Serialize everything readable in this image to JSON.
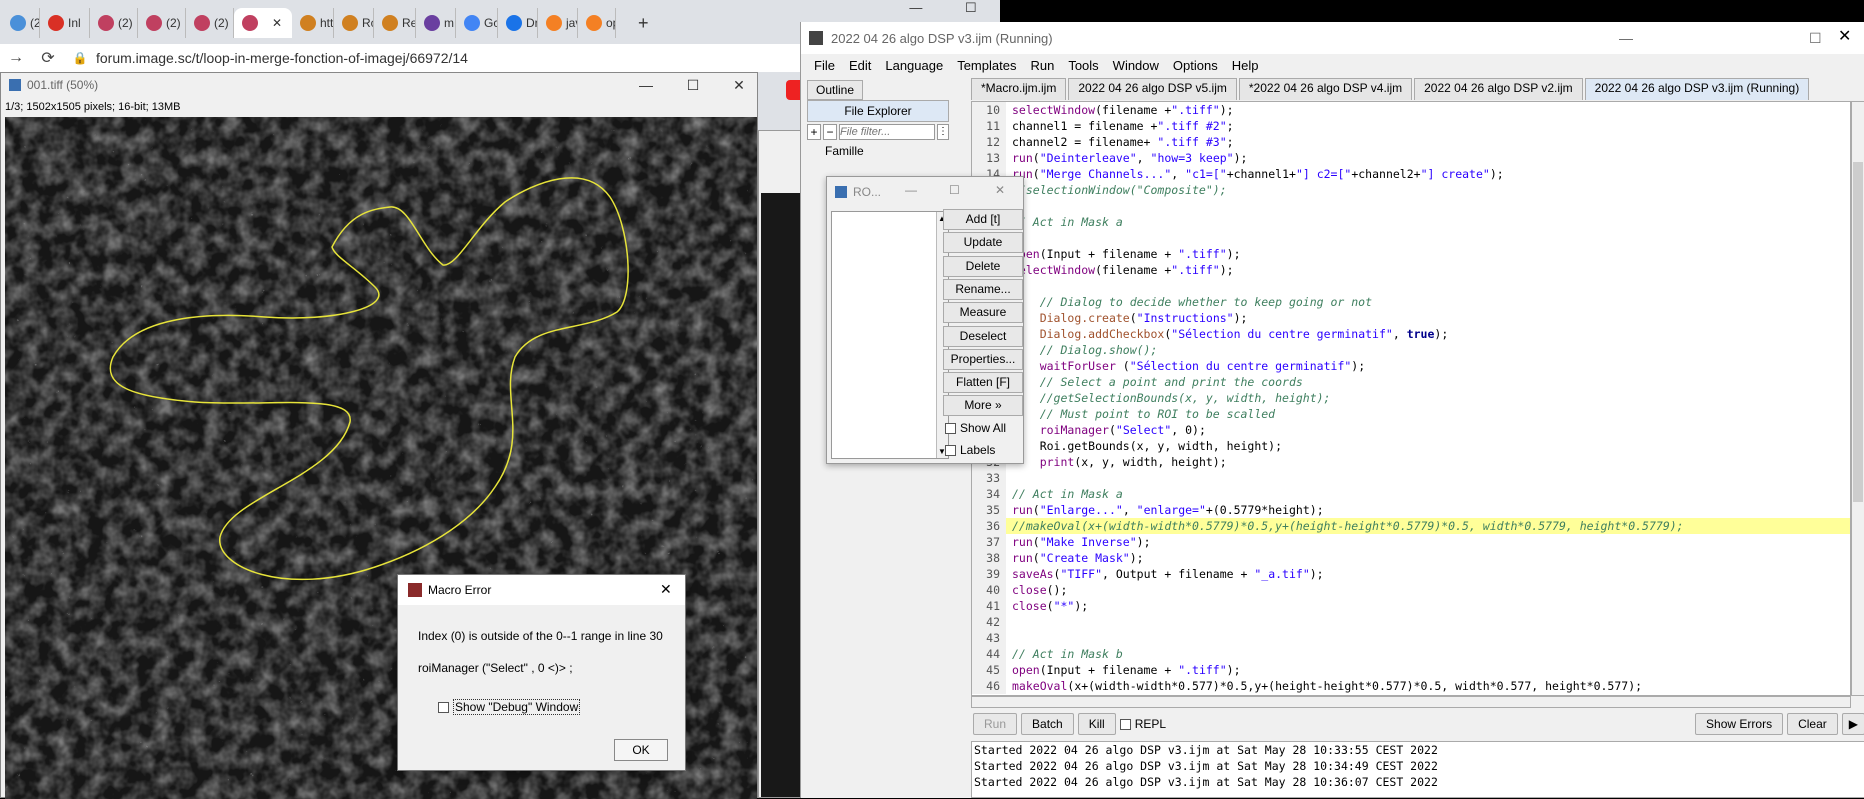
{
  "browser": {
    "tabs": [
      {
        "label": "(2)",
        "icon": "app-icon",
        "color": "#4a90d9"
      },
      {
        "label": "Inl",
        "icon": "gmail-icon",
        "color": "#d93025"
      },
      {
        "label": "(2)",
        "icon": "app-icon",
        "color": "#c04060"
      },
      {
        "label": "(2)",
        "icon": "app-icon",
        "color": "#c04060"
      },
      {
        "label": "(2)",
        "icon": "app-icon",
        "color": "#c04060"
      },
      {
        "label": "",
        "icon": "app-icon",
        "color": "#c04060"
      },
      {
        "label": "htt",
        "icon": "forum-icon",
        "color": "#d08020"
      },
      {
        "label": "Rc",
        "icon": "forum-icon",
        "color": "#d08020"
      },
      {
        "label": "Re",
        "icon": "forum-icon",
        "color": "#d08020"
      },
      {
        "label": "m",
        "icon": "app-icon",
        "color": "#6a3fa0"
      },
      {
        "label": "Gc",
        "icon": "translate-icon",
        "color": "#4285f4"
      },
      {
        "label": "Dr",
        "icon": "app-icon",
        "color": "#1a73e8"
      },
      {
        "label": "jav",
        "icon": "stack-icon",
        "color": "#f48024"
      },
      {
        "label": "op",
        "icon": "stack-icon",
        "color": "#f48024"
      }
    ],
    "url": "forum.image.sc/t/loop-in-merge-fonction-of-imagej/66972/14"
  },
  "image_window": {
    "title": "001.tiff (50%)",
    "info": "1/3; 1502x1505 pixels; 16-bit; 13MB"
  },
  "editor": {
    "title": "2022 04 26 algo DSP v3.ijm (Running)",
    "menu": [
      "File",
      "Edit",
      "Language",
      "Templates",
      "Run",
      "Tools",
      "Window",
      "Options",
      "Help"
    ],
    "side_tabs": [
      "Outline",
      "File Explorer"
    ],
    "file_filter_placeholder": "File filter...",
    "tree_item": "Famille",
    "tabs": [
      "*Macro.ijm.ijm",
      "2022 04 26 algo DSP v5.ijm",
      "*2022 04 26 algo DSP v4.ijm",
      "2022 04 26 algo DSP v2.ijm",
      "2022 04 26 algo DSP v3.ijm (Running)"
    ],
    "code": [
      {
        "n": "10",
        "t": "selectWindow(filename +\".tiff\");"
      },
      {
        "n": "11",
        "t": "channel1 = filename +\".tiff #2\";"
      },
      {
        "n": "12",
        "t": "channel2 = filename+ \".tiff #3\";"
      },
      {
        "n": "13",
        "t": "run(\"Deinterleave\", \"how=3 keep\");"
      },
      {
        "n": "14",
        "t": "run(\"Merge Channels...\", \"c1=[\"+channel1+\"] c2=[\"+channel2+\"] create\");"
      },
      {
        "n": "15",
        "t": "//selectionWindow(\"Composite\");"
      },
      {
        "n": "16",
        "t": ""
      },
      {
        "n": "17",
        "t": "// Act in Mask a"
      },
      {
        "n": "18",
        "t": ""
      },
      {
        "n": "19",
        "t": "open(Input + filename + \".tiff\");"
      },
      {
        "n": "20",
        "t": "selectWindow(filename +\".tiff\");"
      },
      {
        "n": "21",
        "t": ""
      },
      {
        "n": "22",
        "t": "    // Dialog to decide whether to keep going or not"
      },
      {
        "n": "23",
        "t": "    Dialog.create(\"Instructions\");"
      },
      {
        "n": "24",
        "t": "    Dialog.addCheckbox(\"Sélection du centre germinatif\", true);"
      },
      {
        "n": "25",
        "t": "    // Dialog.show();"
      },
      {
        "n": "26",
        "t": "    waitForUser (\"Sélection du centre germinatif\");"
      },
      {
        "n": "27",
        "t": "    // Select a point and print the coords"
      },
      {
        "n": "28",
        "t": "    //getSelectionBounds(x, y, width, height);"
      },
      {
        "n": "29",
        "t": "    // Must point to ROI to be scalled"
      },
      {
        "n": "30",
        "t": "    roiManager(\"Select\", 0);"
      },
      {
        "n": "31",
        "t": "    Roi.getBounds(x, y, width, height);"
      },
      {
        "n": "32",
        "t": "    print(x, y, width, height);"
      },
      {
        "n": "33",
        "t": ""
      },
      {
        "n": "34",
        "t": "// Act in Mask a"
      },
      {
        "n": "35",
        "t": "run(\"Enlarge...\", \"enlarge=\"+(0.5779*height);"
      },
      {
        "n": "36",
        "t": "//makeOval(x+(width-width*0.5779)*0.5,y+(height-height*0.5779)*0.5, width*0.5779, height*0.5779);"
      },
      {
        "n": "37",
        "t": "run(\"Make Inverse\");"
      },
      {
        "n": "38",
        "t": "run(\"Create Mask\");"
      },
      {
        "n": "39",
        "t": "saveAs(\"TIFF\", Output + filename + \"_a.tif\");"
      },
      {
        "n": "40",
        "t": "close();"
      },
      {
        "n": "41",
        "t": "close(\"*\");"
      },
      {
        "n": "42",
        "t": ""
      },
      {
        "n": "43",
        "t": ""
      },
      {
        "n": "44",
        "t": "// Act in Mask b"
      },
      {
        "n": "45",
        "t": "open(Input + filename + \".tiff\");"
      },
      {
        "n": "46",
        "t": "makeOval(x+(width-width*0.577)*0.5,y+(height-height*0.577)*0.5, width*0.577, height*0.577);"
      }
    ],
    "highlight_line": "36",
    "run_buttons": {
      "run": "Run",
      "batch": "Batch",
      "kill": "Kill",
      "repl": "REPL",
      "show_errors": "Show Errors",
      "clear": "Clear"
    },
    "console": [
      "Started 2022 04 26 algo DSP v3.ijm at Sat May 28 10:33:55 CEST 2022",
      "Started 2022 04 26 algo DSP v3.ijm at Sat May 28 10:34:49 CEST 2022",
      "Started 2022 04 26 algo DSP v3.ijm at Sat May 28 10:36:07 CEST 2022"
    ]
  },
  "roi_manager": {
    "title": "RO...",
    "buttons": [
      "Add [t]",
      "Update",
      "Delete",
      "Rename...",
      "Measure",
      "Deselect",
      "Properties...",
      "Flatten [F]",
      "More »"
    ],
    "checkboxes": [
      "Show All",
      "Labels"
    ]
  },
  "macro_error": {
    "title": "Macro Error",
    "message": "Index (0) is outside of the 0--1 range in line 30",
    "code_line": "roiManager (\"Select\" , 0 <)> ;",
    "checkbox": "Show \"Debug\" Window",
    "ok": "OK"
  }
}
